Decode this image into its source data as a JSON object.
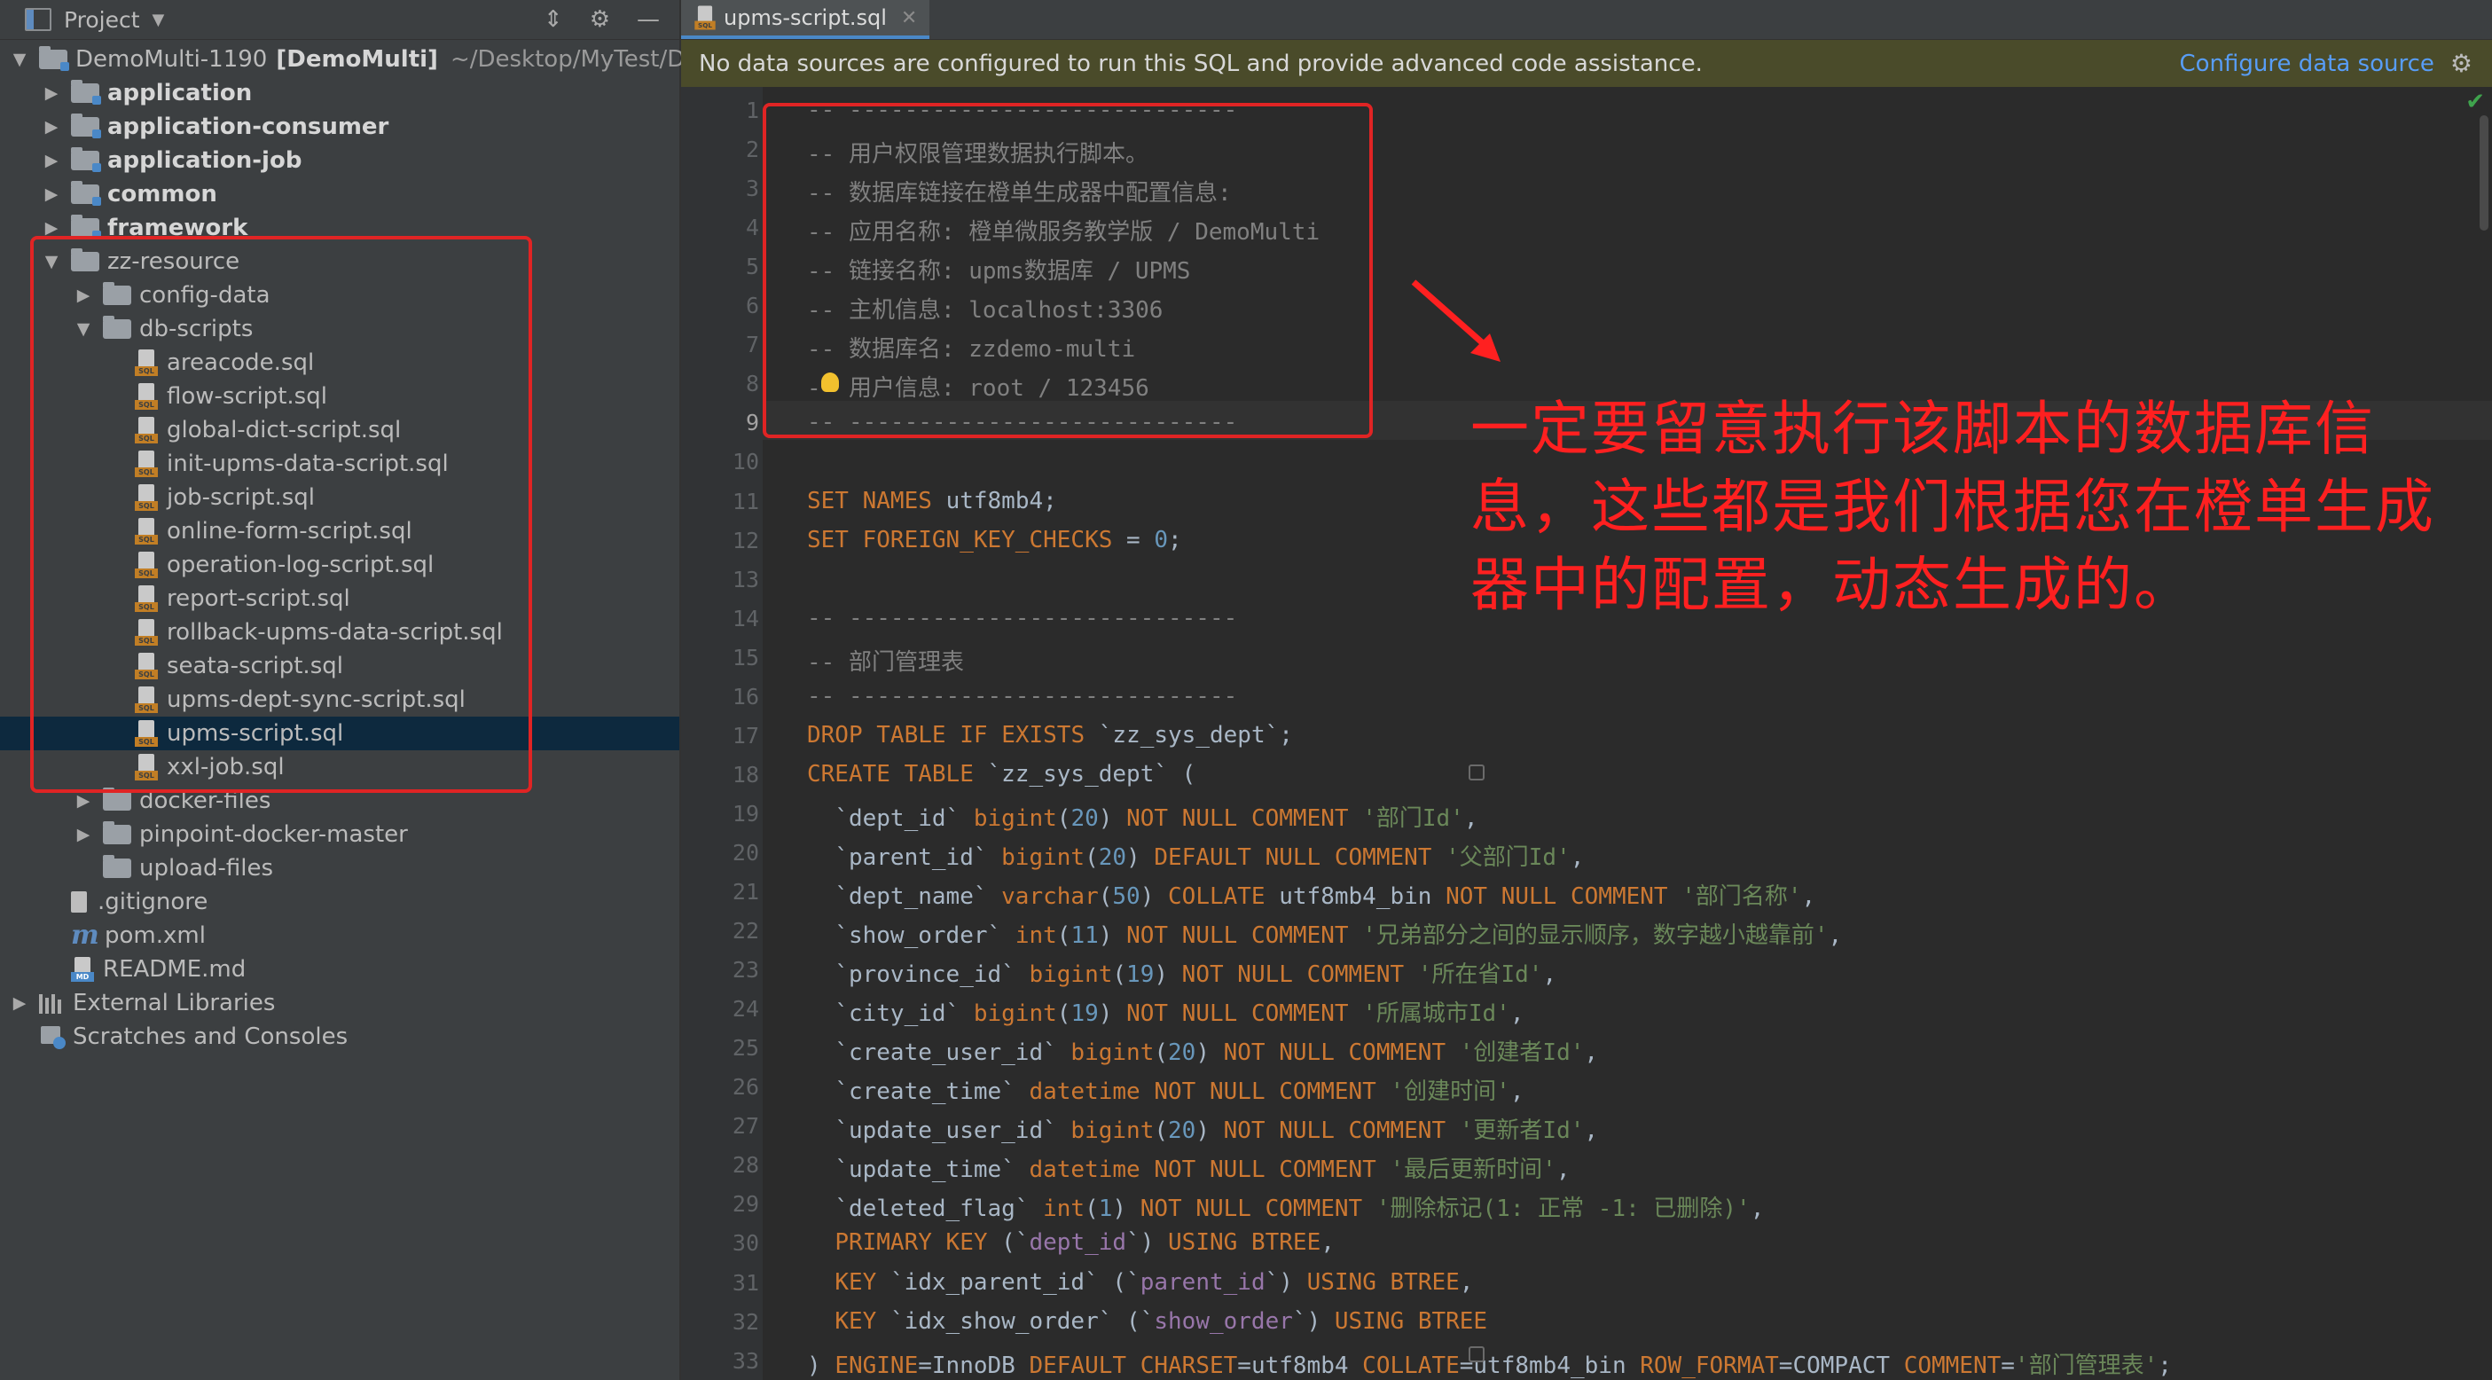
{
  "project_panel": {
    "title": "Project",
    "tree": [
      {
        "label": "DemoMulti-1190",
        "bold_suffix": "[DemoMulti]",
        "path": "~/Desktop/MyTest/D",
        "type": "root",
        "open": true
      },
      {
        "label": "application",
        "type": "module"
      },
      {
        "label": "application-consumer",
        "type": "module"
      },
      {
        "label": "application-job",
        "type": "module"
      },
      {
        "label": "common",
        "type": "module"
      },
      {
        "label": "framework",
        "type": "module"
      },
      {
        "label": "zz-resource",
        "type": "folder",
        "open": true
      },
      {
        "label": "config-data",
        "type": "folder"
      },
      {
        "label": "db-scripts",
        "type": "folder",
        "open": true
      },
      {
        "label": "areacode.sql",
        "type": "sql"
      },
      {
        "label": "flow-script.sql",
        "type": "sql"
      },
      {
        "label": "global-dict-script.sql",
        "type": "sql"
      },
      {
        "label": "init-upms-data-script.sql",
        "type": "sql"
      },
      {
        "label": "job-script.sql",
        "type": "sql"
      },
      {
        "label": "online-form-script.sql",
        "type": "sql"
      },
      {
        "label": "operation-log-script.sql",
        "type": "sql"
      },
      {
        "label": "report-script.sql",
        "type": "sql"
      },
      {
        "label": "rollback-upms-data-script.sql",
        "type": "sql"
      },
      {
        "label": "seata-script.sql",
        "type": "sql"
      },
      {
        "label": "upms-dept-sync-script.sql",
        "type": "sql"
      },
      {
        "label": "upms-script.sql",
        "type": "sql",
        "selected": true
      },
      {
        "label": "xxl-job.sql",
        "type": "sql"
      },
      {
        "label": "docker-files",
        "type": "folder"
      },
      {
        "label": "pinpoint-docker-master",
        "type": "folder"
      },
      {
        "label": "upload-files",
        "type": "folder"
      },
      {
        "label": ".gitignore",
        "type": "file"
      },
      {
        "label": "pom.xml",
        "type": "maven"
      },
      {
        "label": "README.md",
        "type": "md"
      },
      {
        "label": "External Libraries",
        "type": "libs"
      },
      {
        "label": "Scratches and Consoles",
        "type": "scratch"
      }
    ]
  },
  "editor": {
    "tab_label": "upms-script.sql",
    "banner_text": "No data sources are configured to run this SQL and provide advanced code assistance.",
    "banner_link": "Configure data source",
    "current_line": 9,
    "annotation": "一定要留意执行该脚本的数据库信息，这些都是我们根据您在橙单生成器中的配置，动态生成的。",
    "lines": [
      "-- ----------------------------",
      "-- 用户权限管理数据执行脚本。",
      "-- 数据库链接在橙单生成器中配置信息:",
      "-- 应用名称: 橙单微服务教学版 / DemoMulti",
      "-- 链接名称: upms数据库 / UPMS",
      "-- 主机信息: localhost:3306",
      "-- 数据库名: zzdemo-multi",
      "-- 用户信息: root / 123456",
      "-- ----------------------------",
      "",
      "SET NAMES utf8mb4;",
      "SET FOREIGN_KEY_CHECKS = 0;",
      "",
      "-- ----------------------------",
      "-- 部门管理表",
      "-- ----------------------------",
      "DROP TABLE IF EXISTS `zz_sys_dept`;",
      "CREATE TABLE `zz_sys_dept` (",
      "  `dept_id` bigint(20) NOT NULL COMMENT '部门Id',",
      "  `parent_id` bigint(20) DEFAULT NULL COMMENT '父部门Id',",
      "  `dept_name` varchar(50) COLLATE utf8mb4_bin NOT NULL COMMENT '部门名称',",
      "  `show_order` int(11) NOT NULL COMMENT '兄弟部分之间的显示顺序，数字越小越靠前',",
      "  `province_id` bigint(19) NOT NULL COMMENT '所在省Id',",
      "  `city_id` bigint(19) NOT NULL COMMENT '所属城市Id',",
      "  `create_user_id` bigint(20) NOT NULL COMMENT '创建者Id',",
      "  `create_time` datetime NOT NULL COMMENT '创建时间',",
      "  `update_user_id` bigint(20) NOT NULL COMMENT '更新者Id',",
      "  `update_time` datetime NOT NULL COMMENT '最后更新时间',",
      "  `deleted_flag` int(1) NOT NULL COMMENT '删除标记(1: 正常 -1: 已删除)',",
      "  PRIMARY KEY (`dept_id`) USING BTREE,",
      "  KEY `idx_parent_id` (`parent_id`) USING BTREE,",
      "  KEY `idx_show_order` (`show_order`) USING BTREE",
      ") ENGINE=InnoDB DEFAULT CHARSET=utf8mb4 COLLATE=utf8mb4_bin ROW_FORMAT=COMPACT COMMENT='部门管理表';"
    ]
  }
}
